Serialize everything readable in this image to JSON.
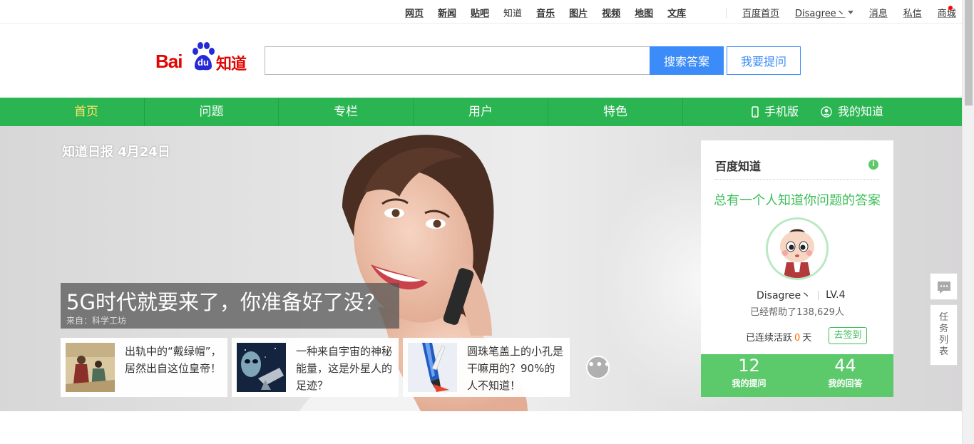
{
  "topbar": {
    "links": [
      "网页",
      "新闻",
      "贴吧",
      "知道",
      "音乐",
      "图片",
      "视频",
      "地图",
      "文库"
    ],
    "active_link": "知道",
    "right": {
      "home": "百度首页",
      "username": "Disagree丶",
      "messages": "消息",
      "private_messages": "私信",
      "mall": "商城"
    }
  },
  "header": {
    "logo_text": "Bai",
    "logo_du": "du",
    "logo_product": "知道",
    "search_placeholder": "",
    "search_button": "搜索答案",
    "ask_button": "我要提问"
  },
  "nav": {
    "items": [
      "首页",
      "问题",
      "专栏",
      "用户",
      "特色"
    ],
    "mobile": "手机版",
    "my_zhidao": "我的知道"
  },
  "banner": {
    "daily_label": "知道日报 4月24日",
    "headline": "5G时代就要来了，你准备好了没？",
    "source": "来自：科学工坊",
    "more": "•••",
    "cards": [
      {
        "text": "出轨中的“戴绿帽”，居然出自这位皇帝！"
      },
      {
        "text": "一种来自宇宙的神秘能量，这是外星人的足迹？"
      },
      {
        "text": "圆珠笔盖上的小孔是干嘛用的？90%的人不知道！"
      }
    ]
  },
  "panel": {
    "title": "百度知道",
    "info_icon": "i",
    "slogan": "总有一个人知道你问题的答案",
    "username": "Disagree丶",
    "level": "LV.4",
    "helped": "已经帮助了138,629人",
    "streak_prefix": "已连续活跃",
    "streak_days": "0",
    "streak_suffix": "天",
    "signin": "去签到",
    "questions_count": "12",
    "questions_label": "我的提问",
    "answers_count": "44",
    "answers_label": "我的回答"
  },
  "floating": {
    "tasks": [
      "任",
      "务",
      "列",
      "表"
    ]
  },
  "colors": {
    "nav_green": "#2ab552",
    "stats_green": "#5cc96b",
    "search_blue": "#3b8cf8",
    "brand_red": "#e10602",
    "active_yellow": "#ffe36b"
  }
}
